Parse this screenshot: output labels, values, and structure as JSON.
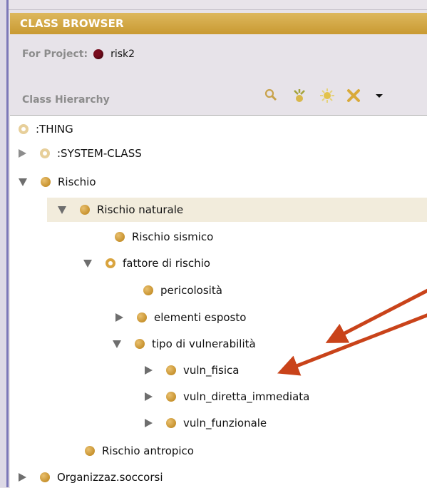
{
  "window": {
    "title": "CLASS BROWSER"
  },
  "project": {
    "label": "For Project:",
    "name": "risk2",
    "icon": "project-icon"
  },
  "hierarchy": {
    "label": "Class Hierarchy"
  },
  "toolbar": {
    "icons": [
      "find-class-icon",
      "create-subclass-icon",
      "create-class-icon",
      "delete-class-icon",
      "menu-dropdown-icon"
    ]
  },
  "tree": {
    "items": [
      {
        "label": ":THING",
        "depth": 0,
        "toggle": "none",
        "icon": "ring-light"
      },
      {
        "label": ":SYSTEM-CLASS",
        "depth": 0,
        "toggle": "right",
        "icon": "ring-light"
      },
      {
        "label": "Rischio",
        "depth": 0,
        "toggle": "down",
        "icon": "solid"
      },
      {
        "label": "Rischio naturale",
        "depth": 1,
        "toggle": "down",
        "icon": "solid",
        "selected": true
      },
      {
        "label": "Rischio sismico",
        "depth": 2,
        "toggle": "none",
        "icon": "solid"
      },
      {
        "label": "fattore di rischio",
        "depth": 2,
        "toggle": "down",
        "icon": "ring"
      },
      {
        "label": "pericolosità",
        "depth": 3,
        "toggle": "none",
        "icon": "solid"
      },
      {
        "label": "elementi esposto",
        "depth": 3,
        "toggle": "right",
        "icon": "solid"
      },
      {
        "label": "tipo di vulnerabilità",
        "depth": 3,
        "toggle": "down",
        "icon": "solid"
      },
      {
        "label": "vuln_fisica",
        "depth": 4,
        "toggle": "right",
        "icon": "solid"
      },
      {
        "label": "vuln_diretta_immediata",
        "depth": 4,
        "toggle": "right",
        "icon": "solid"
      },
      {
        "label": "vuln_funzionale",
        "depth": 4,
        "toggle": "right",
        "icon": "solid"
      },
      {
        "label": "Rischio antropico",
        "depth": 1,
        "toggle": "none",
        "icon": "solid"
      },
      {
        "label": "Organizzaz.soccorsi",
        "depth": 0,
        "toggle": "right",
        "icon": "solid"
      }
    ]
  },
  "colors": {
    "title_bar": "#c99a32",
    "class_icon": "#d9a43f",
    "annotation_arrow": "#c9431a",
    "project_icon": "#7a0c1e"
  }
}
